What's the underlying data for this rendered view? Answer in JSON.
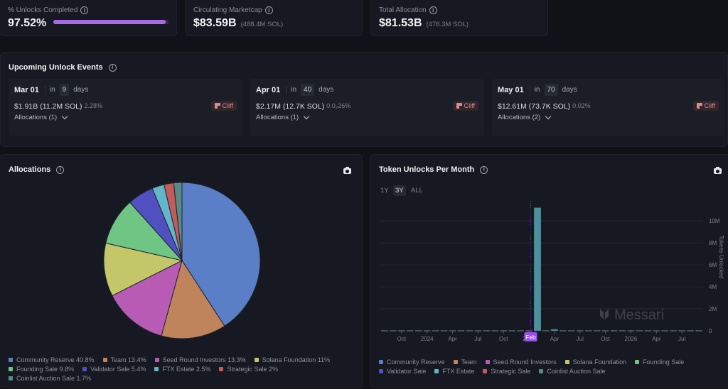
{
  "stats": [
    {
      "label": "% Unlocks Completed",
      "value": "97.52%",
      "progress": 0.9752
    },
    {
      "label": "Circulating Marketcap",
      "value": "$83.59B",
      "sub": "(488.4M SOL)"
    },
    {
      "label": "Total Allocation",
      "value": "$81.53B",
      "sub": "(476.3M SOL)"
    }
  ],
  "upcoming": {
    "title": "Upcoming Unlock Events",
    "events": [
      {
        "date": "Mar 01",
        "in": "in",
        "days": "9",
        "days_label": "days",
        "amount": "$1.91B (11.2M SOL)",
        "pct": "2.28%",
        "allocations": "Allocations (1)",
        "badge": "Cliff"
      },
      {
        "date": "Apr 01",
        "in": "in",
        "days": "40",
        "days_label": "days",
        "amount": "$2.17M (12.7K SOL)",
        "pct": "0.0₂26%",
        "allocations": "Allocations (1)",
        "badge": "Cliff"
      },
      {
        "date": "May 01",
        "in": "in",
        "days": "70",
        "days_label": "days",
        "amount": "$12.61M (73.7K SOL)",
        "pct": "0.02%",
        "allocations": "Allocations (2)",
        "badge": "Cliff"
      }
    ]
  },
  "allocations": {
    "title": "Allocations",
    "legend": [
      {
        "label": "Community Reserve 40.8%",
        "color": "#5b7fc7"
      },
      {
        "label": "Team 13.4%",
        "color": "#c0845c"
      },
      {
        "label": "Seed Round Investors 13.3%",
        "color": "#b85bb4"
      },
      {
        "label": "Solana Foundation 11%",
        "color": "#c3c76a"
      },
      {
        "label": "Founding Sale 9.8%",
        "color": "#6fc583"
      },
      {
        "label": "Validator Sale 5.4%",
        "color": "#5050c0"
      },
      {
        "label": "FTX Estate 2.5%",
        "color": "#63b5c8"
      },
      {
        "label": "Strategic Sale 2%",
        "color": "#c25b5b"
      },
      {
        "label": "Coinlist Auction Sale 1.7%",
        "color": "#5a8a86"
      }
    ]
  },
  "token_unlocks": {
    "title": "Token Unlocks Per Month",
    "ranges": [
      "1Y",
      "3Y",
      "ALL"
    ],
    "active_range": "3Y",
    "watermark": "Messari",
    "today_marker": "Feb",
    "legend": [
      {
        "label": "Community Reserve",
        "color": "#5b7fc7"
      },
      {
        "label": "Team",
        "color": "#c0845c"
      },
      {
        "label": "Seed Round Investors",
        "color": "#b85bb4"
      },
      {
        "label": "Solana Foundation",
        "color": "#c3c76a"
      },
      {
        "label": "Founding Sale",
        "color": "#6fc583"
      },
      {
        "label": "Validator Sale",
        "color": "#5050c0"
      },
      {
        "label": "FTX Estate",
        "color": "#63b5c8"
      },
      {
        "label": "Strategic Sale",
        "color": "#c25b5b"
      },
      {
        "label": "Coinlist Auction Sale",
        "color": "#5a8a86"
      }
    ]
  },
  "chart_data": [
    {
      "type": "pie",
      "title": "Allocations",
      "categories": [
        "Community Reserve",
        "Team",
        "Seed Round Investors",
        "Solana Foundation",
        "Founding Sale",
        "Validator Sale",
        "FTX Estate",
        "Strategic Sale",
        "Coinlist Auction Sale"
      ],
      "values": [
        40.8,
        13.4,
        13.3,
        11,
        9.8,
        5.4,
        2.5,
        2,
        1.7
      ],
      "colors": [
        "#5b7fc7",
        "#c0845c",
        "#b85bb4",
        "#c3c76a",
        "#6fc583",
        "#5050c0",
        "#63b5c8",
        "#c25b5b",
        "#5a8a86"
      ],
      "legend": "bottom"
    },
    {
      "type": "bar",
      "title": "Token Unlocks Per Month",
      "ylabel": "Tokens Unlocked",
      "ylim": [
        0,
        11500000
      ],
      "yticks": [
        "0",
        "2M",
        "4M",
        "6M",
        "8M",
        "10M"
      ],
      "ytick_values": [
        0,
        2000000,
        4000000,
        6000000,
        8000000,
        10000000
      ],
      "xticks": [
        "Oct",
        "2024",
        "Apr",
        "Jul",
        "Oct",
        "2025",
        "Apr",
        "Jul",
        "Oct",
        "2026",
        "Apr",
        "Jul"
      ],
      "xtick_months": [
        2,
        5,
        8,
        11,
        14,
        17,
        20,
        23,
        26,
        29,
        32,
        35
      ],
      "months_count": 38,
      "today_month_index": 17.7,
      "series": [
        {
          "name": "FTX Estate",
          "color": "#4f8f9c",
          "values": [
            0,
            0,
            0,
            0,
            0,
            0,
            0,
            0,
            0,
            0,
            0,
            0,
            0,
            0,
            0,
            0,
            0,
            0,
            11200000,
            0,
            70000,
            0,
            0,
            0,
            0,
            0,
            0,
            0,
            0,
            0,
            0,
            0,
            0,
            0,
            0,
            0,
            0,
            0
          ]
        }
      ],
      "grid": true,
      "legend": "bottom"
    }
  ]
}
